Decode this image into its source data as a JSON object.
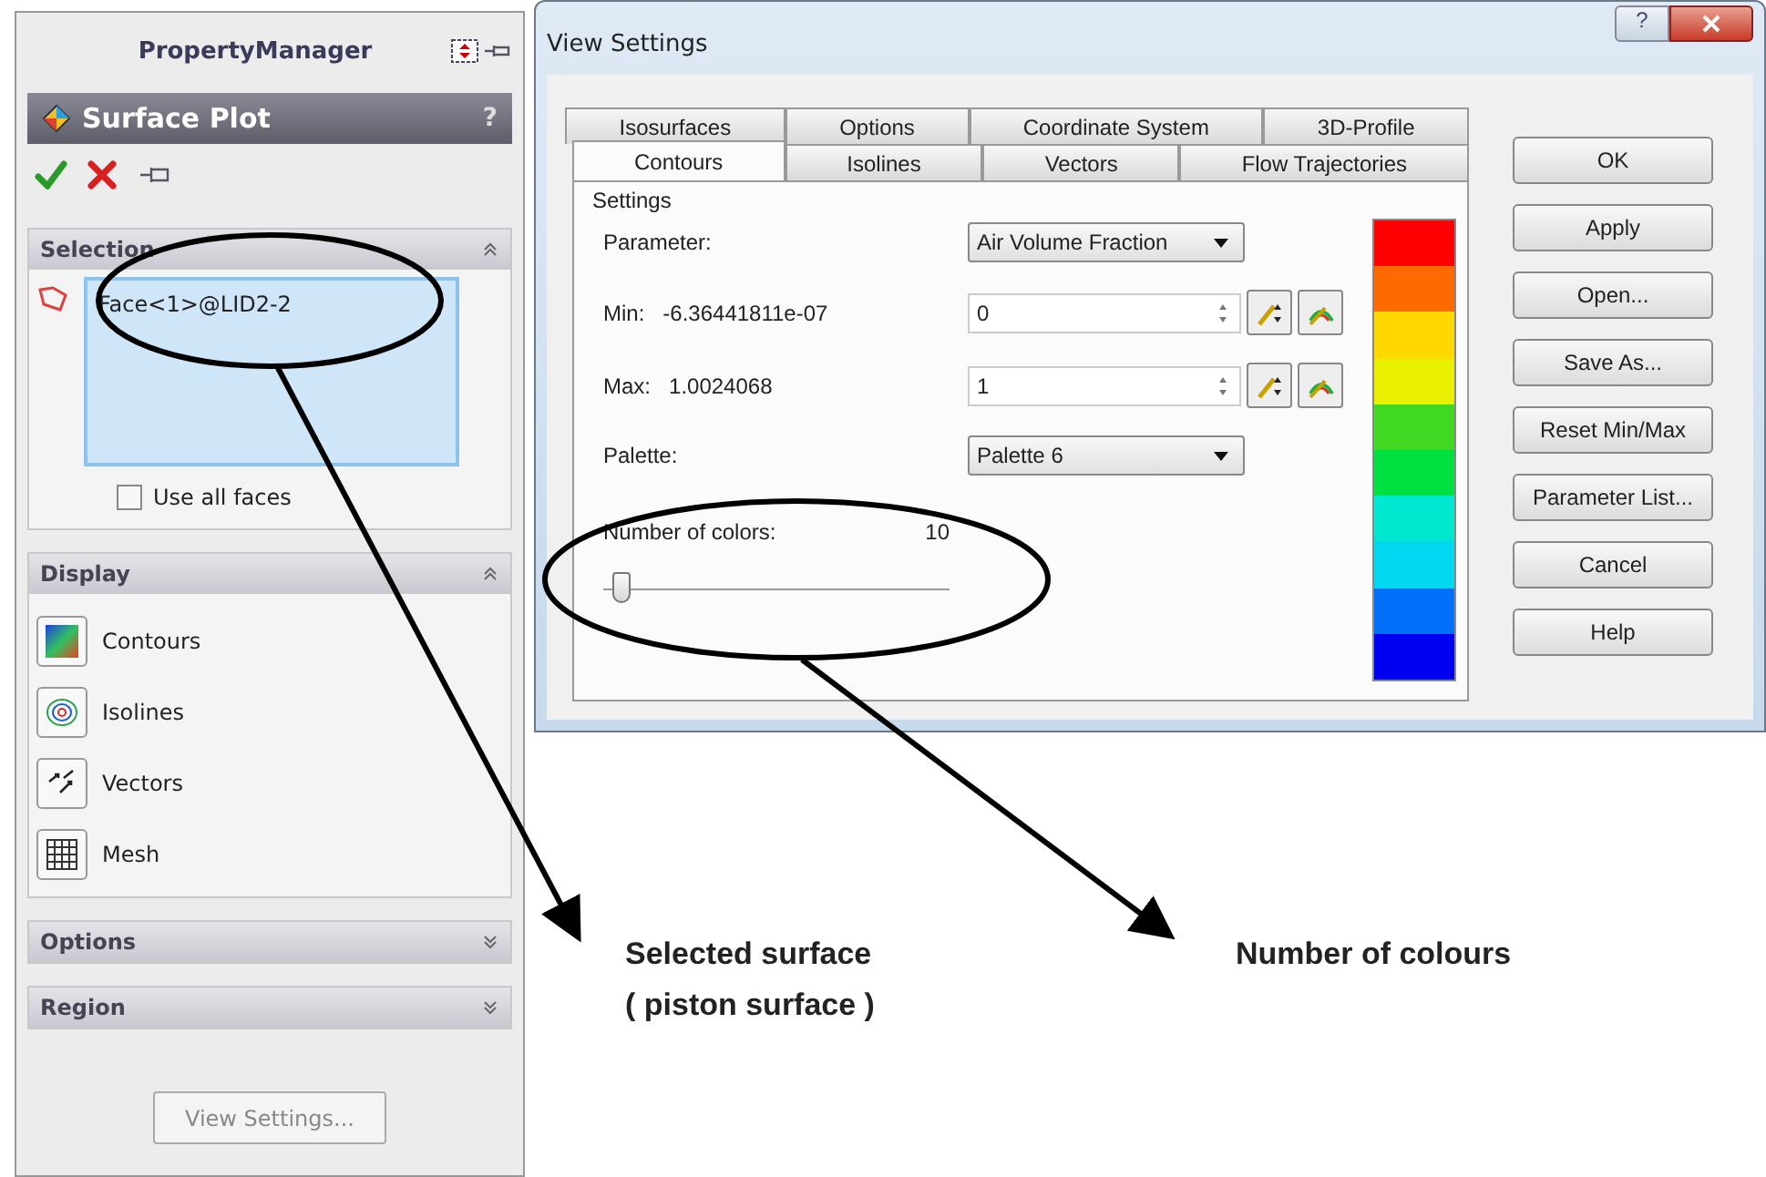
{
  "property_manager": {
    "title": "PropertyManager",
    "feature_title": "Surface Plot",
    "help": "?",
    "selection": {
      "title": "Selection",
      "expanded": true,
      "items": [
        "Face<1>@LID2-2"
      ],
      "use_all_faces": {
        "label": "Use all faces",
        "checked": false
      }
    },
    "display": {
      "title": "Display",
      "expanded": true,
      "items": [
        {
          "label": "Contours",
          "kind": "contours"
        },
        {
          "label": "Isolines",
          "kind": "isolines"
        },
        {
          "label": "Vectors",
          "kind": "vectors"
        },
        {
          "label": "Mesh",
          "kind": "mesh"
        }
      ]
    },
    "options": {
      "title": "Options",
      "expanded": false
    },
    "region": {
      "title": "Region",
      "expanded": false
    },
    "view_settings_button": {
      "label": "View Settings...",
      "disabled": true
    }
  },
  "dialog": {
    "title": "View Settings",
    "help": "?",
    "tab_rows": [
      [
        {
          "label": "Isosurfaces",
          "selected": false
        },
        {
          "label": "Options",
          "selected": false
        },
        {
          "label": "Coordinate System",
          "selected": false
        },
        {
          "label": "3D-Profile",
          "selected": false
        }
      ],
      [
        {
          "label": "Contours",
          "selected": true
        },
        {
          "label": "Isolines",
          "selected": false
        },
        {
          "label": "Vectors",
          "selected": false
        },
        {
          "label": "Flow Trajectories",
          "selected": false
        }
      ]
    ],
    "settings": {
      "legend": "Settings",
      "parameter": {
        "label": "Parameter:",
        "value": "Air Volume Fraction"
      },
      "min": {
        "label": "Min:",
        "reading": "-6.36441811e-07",
        "value": "0"
      },
      "max": {
        "label": "Max:",
        "reading": "1.0024068",
        "value": "1"
      },
      "palette": {
        "label": "Palette:",
        "value": "Palette 6"
      },
      "number_of_colors": {
        "label": "Number of colors:",
        "value": "10",
        "level": 0.05
      }
    },
    "palette_colors": [
      {
        "color": "#ff0000"
      },
      {
        "color": "#ff6a00"
      },
      {
        "color": "#ffd800"
      },
      {
        "color": "#e8f000"
      },
      {
        "color": "#40d820"
      },
      {
        "color": "#00e040"
      },
      {
        "color": "#00e8d0"
      },
      {
        "color": "#00d8f0"
      },
      {
        "color": "#0070f8"
      },
      {
        "color": "#0000f0"
      }
    ],
    "buttons": [
      "OK",
      "Apply",
      "Open...",
      "Save As...",
      "Reset Min/Max",
      "Parameter List...",
      "Cancel",
      "Help"
    ]
  },
  "annotations": [
    {
      "text": "Selected surface\n( piston surface )"
    },
    {
      "text": "Number of colours"
    }
  ]
}
